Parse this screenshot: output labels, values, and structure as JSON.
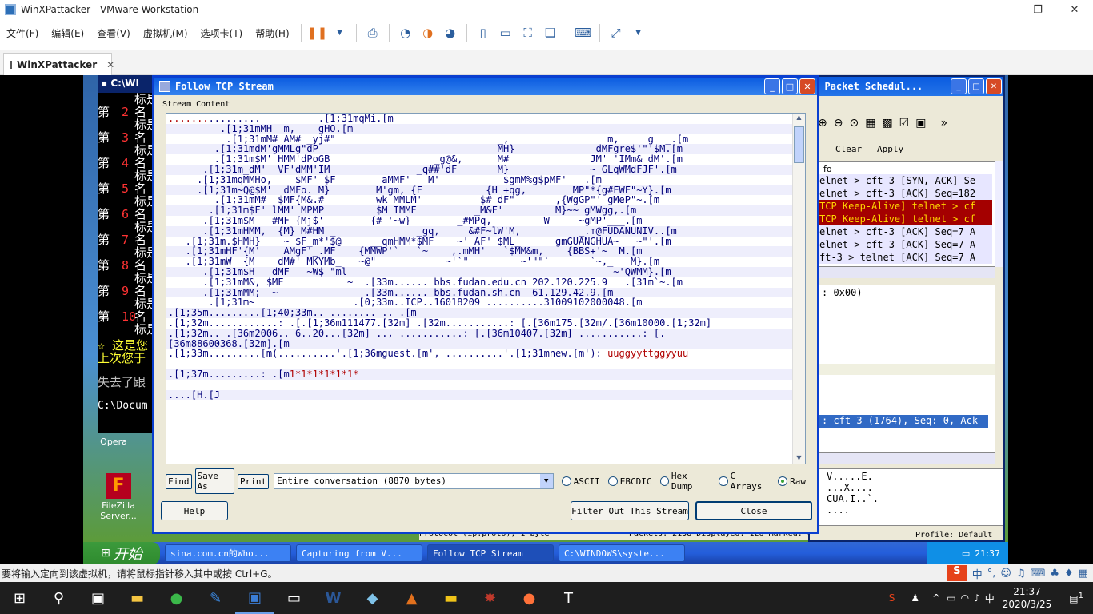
{
  "vm": {
    "title": "WinXPattacker - VMware Workstation",
    "menu": [
      "文件(F)",
      "编辑(E)",
      "查看(V)",
      "虚拟机(M)",
      "选项卡(T)",
      "帮助(H)"
    ],
    "tab_label": "WinXPattacker",
    "status_text": "要将输入定向到该虚拟机，请将鼠标指针移入其中或按 Ctrl+G。",
    "ime_label": "中"
  },
  "cmd": {
    "title": "C:\\WI",
    "lines": [
      {
        "a": "",
        "b": "",
        "c": "标是"
      },
      {
        "a": "第",
        "b": "2",
        "c": "名"
      },
      {
        "a": "",
        "b": "",
        "c": "标是"
      },
      {
        "a": "第",
        "b": "3",
        "c": "名"
      },
      {
        "a": "",
        "b": "",
        "c": "标是"
      },
      {
        "a": "第",
        "b": "4",
        "c": "名"
      },
      {
        "a": "",
        "b": "",
        "c": "标是"
      },
      {
        "a": "第",
        "b": "5",
        "c": "名"
      },
      {
        "a": "",
        "b": "",
        "c": "标是"
      },
      {
        "a": "第",
        "b": "6",
        "c": "名"
      },
      {
        "a": "",
        "b": "",
        "c": "标是"
      },
      {
        "a": "第",
        "b": "7",
        "c": "名"
      },
      {
        "a": "",
        "b": "",
        "c": "标是"
      },
      {
        "a": "第",
        "b": "8",
        "c": "名"
      },
      {
        "a": "",
        "b": "",
        "c": "标是"
      },
      {
        "a": "第",
        "b": "9",
        "c": "名"
      },
      {
        "a": "",
        "b": "",
        "c": "标是"
      },
      {
        "a": "第",
        "b": "10",
        "c": "名"
      },
      {
        "a": "",
        "b": "",
        "c": "标是"
      }
    ],
    "tail1": "☆ 这是您",
    "tail2": "上次您于",
    "tail3": "失去了跟",
    "prompt": "C:\\Docum"
  },
  "desktop": {
    "opera_label": "Opera",
    "filezilla_label": "FileZilla Server..."
  },
  "wireshark": {
    "title": "s Packet Schedul...",
    "clear": "Clear",
    "apply": "Apply",
    "col_info": "fo",
    "rows": [
      {
        "text": "elnet > cft-3 [SYN, ACK] Se",
        "style": "normal"
      },
      {
        "text": "elnet > cft-3 [ACK] Seq=182",
        "style": "normal"
      },
      {
        "text": "TCP Keep-Alive] telnet > cf",
        "style": "alert"
      },
      {
        "text": "TCP Keep-Alive] telnet > cf",
        "style": "alert"
      },
      {
        "text": "elnet > cft-3 [ACK] Seq=7 A",
        "style": "normal"
      },
      {
        "text": "elnet > cft-3 [ACK] Seq=7 A",
        "style": "normal"
      },
      {
        "text": "ft-3 > telnet [ACK] Seq=7 A",
        "style": "normal"
      }
    ],
    "detail1": ": 0x00)",
    "detail_sel": ": cft-3 (1764), Seq: 0, Ack",
    "hex": [
      "V.....E.",
      "...X....",
      "CUA.I..`.",
      "...."
    ],
    "status_profile": "Profile: Default",
    "status_packets": "Packets: 2158 Displayed: 126 Marked: 0",
    "status_proto": "Protocol (ip.proto), 1 byte"
  },
  "dialog": {
    "title": "Follow TCP Stream",
    "stream_label": "Stream Content",
    "lines": [
      {
        "t": ".........",
        "r": ".......",
        "u": "          .[1;31mqMi.[m",
        "c": false
      },
      {
        "t": "         .[1;31mMH  m,   _gHO.[m",
        "c": true
      },
      {
        "t": "          .[1;31mM# AM# _yj#\"                            _,                 m,     g  _.[m",
        "c": false
      },
      {
        "t": "        .[1;31mdM'gMMLg\"dP                               MH}              dMFgre$'\"'$M.[m",
        "c": true
      },
      {
        "t": "        .[1;31m$M' HMM'dPoGB                  _g@&,      M#              JM' 'IMm& dM'.[m",
        "c": false
      },
      {
        "t": "      .[1;31m_dM'  VF'dMM'IM               _q##'dF       M}              ~ GLqWMdFJF'.[m",
        "c": true
      },
      {
        "t": "     .[1;31mqMMHo,    $MF' $F        aMMF'   M'           $gmM%g$pMF'___.[m",
        "c": false
      },
      {
        "t": "     .[1;31m~Q@$M'  dMFo. M}        M'gm, {F           {H +qg,        MP\"*{g#FWF\"~Y}.[m",
        "c": true
      },
      {
        "t": "        .[1;31mM#  $MF{M&.#         wk MMLM'          $# dF\"       ,{WgGP\"'_gMeP\"~.[m",
        "c": false
      },
      {
        "t": "       .[1;31m$F' lMM' MPMP         $M IMMF          _M&F'         M}~~ gMWgg,.[m",
        "c": true
      },
      {
        "t": "      .[1;31m$M   #MF {Mj$'        {# '~w}        _#MPq,         W     ~gMP'___.[m",
        "c": false
      },
      {
        "t": "      .[1;31mHMM,  {M} M#HM _              _gq,     &#F~lW'M,          _.m@FUDANUNIV..[m",
        "c": true
      },
      {
        "t": "   .[1;31m.$HMH}    ~ $F_m*'$@     __qmHMM*$MF    ~' AF' $ML_      gmGUANGHUA~   ~\"'.[m",
        "c": false
      },
      {
        "t": "   .[1;31mHF'{M'    AMgF'_.MF    {MMWP'`   `~    ,.mMH'   `$MM&m,    {BBS+'~  M.[m",
        "c": true
      },
      {
        "t": "   .[1;31mW  {M    dM#' MKYMb_   ~@\"            ~'`\"         ~'\"\"`       `~,_   M}.[m",
        "c": false
      },
      {
        "t": "      .[1;31m$H   dMF   ~W$ \"ml                                              ~'QWMM}.[m",
        "c": true
      },
      {
        "t": "      .[1;31mM&, $MF           ~  .[33m...... bbs.fudan.edu.cn 202.120.225.9   .[31m`~.[m",
        "c": false
      },
      {
        "t": "      .[1;31mMM;  ~               .[33m...... bbs.fudan.sh.cn  61.129.42.9.[m",
        "c": true
      },
      {
        "t": "       .[1;31m~                 .[0;33m..ICP..16018209 ..........31009102000048.[m",
        "c": false
      },
      {
        "t": ".[1;35m.........[1;40;33m.. ........ .. .[m",
        "c": true
      },
      {
        "t": ".[1;32m............: .[.[1;36m111477.[32m] .[32m...........: [.[36m175.[32m/.[36m10000.[1;32m]",
        "c": false
      },
      {
        "t": ".[1;32m.. .[36m2006.. 6..20...[32m] .., ...........: [.[36m10407.[32m] ...........: [.",
        "c": true
      },
      {
        "t": "[36m88600368.[32m].[m",
        "c": true
      },
      {
        "t": ".[1;33m.........[m(..........'.[1;36mguest.[m', ..........'.[1;31mnew.[m'): ",
        "r2": "uuggyyttggyyuu",
        "c": false
      },
      {
        "t": "",
        "c": false
      },
      {
        "t": ".[1;37m.........: .[m",
        "r2": "1*1*1*1*1*1*",
        "c": true
      },
      {
        "t": "",
        "c": false
      },
      {
        "t": "....[H.[J",
        "c": true
      }
    ],
    "find": "Find",
    "save_as": "Save As",
    "print": "Print",
    "conversation": "Entire conversation (8870 bytes)",
    "radios": [
      "ASCII",
      "EBCDIC",
      "Hex Dump",
      "C Arrays",
      "Raw"
    ],
    "radio_selected": "Raw",
    "help": "Help",
    "filter_out": "Filter Out This Stream",
    "close": "Close"
  },
  "xp_taskbar": {
    "start": "开始",
    "items": [
      {
        "label": "sina.com.cn的Who...",
        "active": false
      },
      {
        "label": "Capturing from V...",
        "active": false
      },
      {
        "label": "Follow TCP Stream",
        "active": true
      },
      {
        "label": "C:\\WINDOWS\\syste...",
        "active": false
      }
    ],
    "clock": "21:37"
  },
  "win_taskbar": {
    "time": "21:37",
    "date": "2020/3/25",
    "notif_count": "1"
  },
  "colors": {
    "xp_title_blue": "#0a5be0",
    "stream_text": "#00007a",
    "stream_highlight": "#eeeefc",
    "alert_row_bg": "#a40000",
    "alert_row_fg": "#ffd700"
  }
}
